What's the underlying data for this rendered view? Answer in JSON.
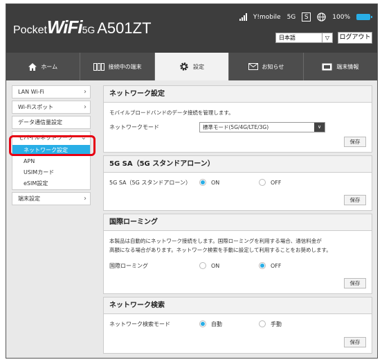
{
  "header": {
    "logo_pocket": "Pocket",
    "logo_wifi": "WiFi",
    "logo_5g": "5G",
    "model": "A501ZT",
    "carrier": "Y!mobile",
    "network": "5G",
    "sim_indicator": "S",
    "battery": "100%",
    "language": "日本語",
    "logout": "ログアウト"
  },
  "nav": {
    "tabs": [
      {
        "label": "ホーム",
        "icon": "home-icon"
      },
      {
        "label": "接続中の端末",
        "icon": "devices-icon"
      },
      {
        "label": "設定",
        "icon": "gear-icon"
      },
      {
        "label": "お知らせ",
        "icon": "mail-icon"
      },
      {
        "label": "端末情報",
        "icon": "info-icon"
      }
    ],
    "active": "設定"
  },
  "sidebar": {
    "items": [
      {
        "label": "LAN Wi-Fi"
      },
      {
        "label": "Wi-Fiスポット"
      },
      {
        "label": "データ通信量設定"
      }
    ],
    "group": {
      "label": "モバイルネットワーク",
      "subitems": [
        "ネットワーク設定",
        "APN",
        "USIMカード",
        "eSIM設定"
      ]
    },
    "last": {
      "label": "端末設定"
    }
  },
  "network_settings": {
    "title": "ネットワーク設定",
    "description": "モバイルブロードバンドのデータ接続を管理します。",
    "mode_label": "ネットワークモード",
    "mode_value": "標準モード(5G/4G/LTE/3G)",
    "save": "保存"
  },
  "sa_settings": {
    "title": "5G SA（5G スタンドアローン）",
    "label": "5G SA（5G スタンドアローン）",
    "opt_on": "ON",
    "opt_off": "OFF",
    "selected": "ON",
    "save": "保存"
  },
  "roaming": {
    "title": "国際ローミング",
    "description_1": "本製品は自動的にネットワーク接続をします。国際ローミングを利用する場合、通信料金が",
    "description_2": "高額になる場合があります。ネットワーク検索を手動に設定して利用することをお奨めします。",
    "label": "国際ローミング",
    "opt_on": "ON",
    "opt_off": "OFF",
    "selected": "OFF",
    "save": "保存"
  },
  "search": {
    "title": "ネットワーク検索",
    "label": "ネットワーク検索モード",
    "opt_auto": "自動",
    "opt_manual": "手動",
    "selected": "自動",
    "save": "保存"
  },
  "colors": {
    "accent": "#29aee6",
    "highlight": "#e60012",
    "header": "#3d3d3d"
  }
}
